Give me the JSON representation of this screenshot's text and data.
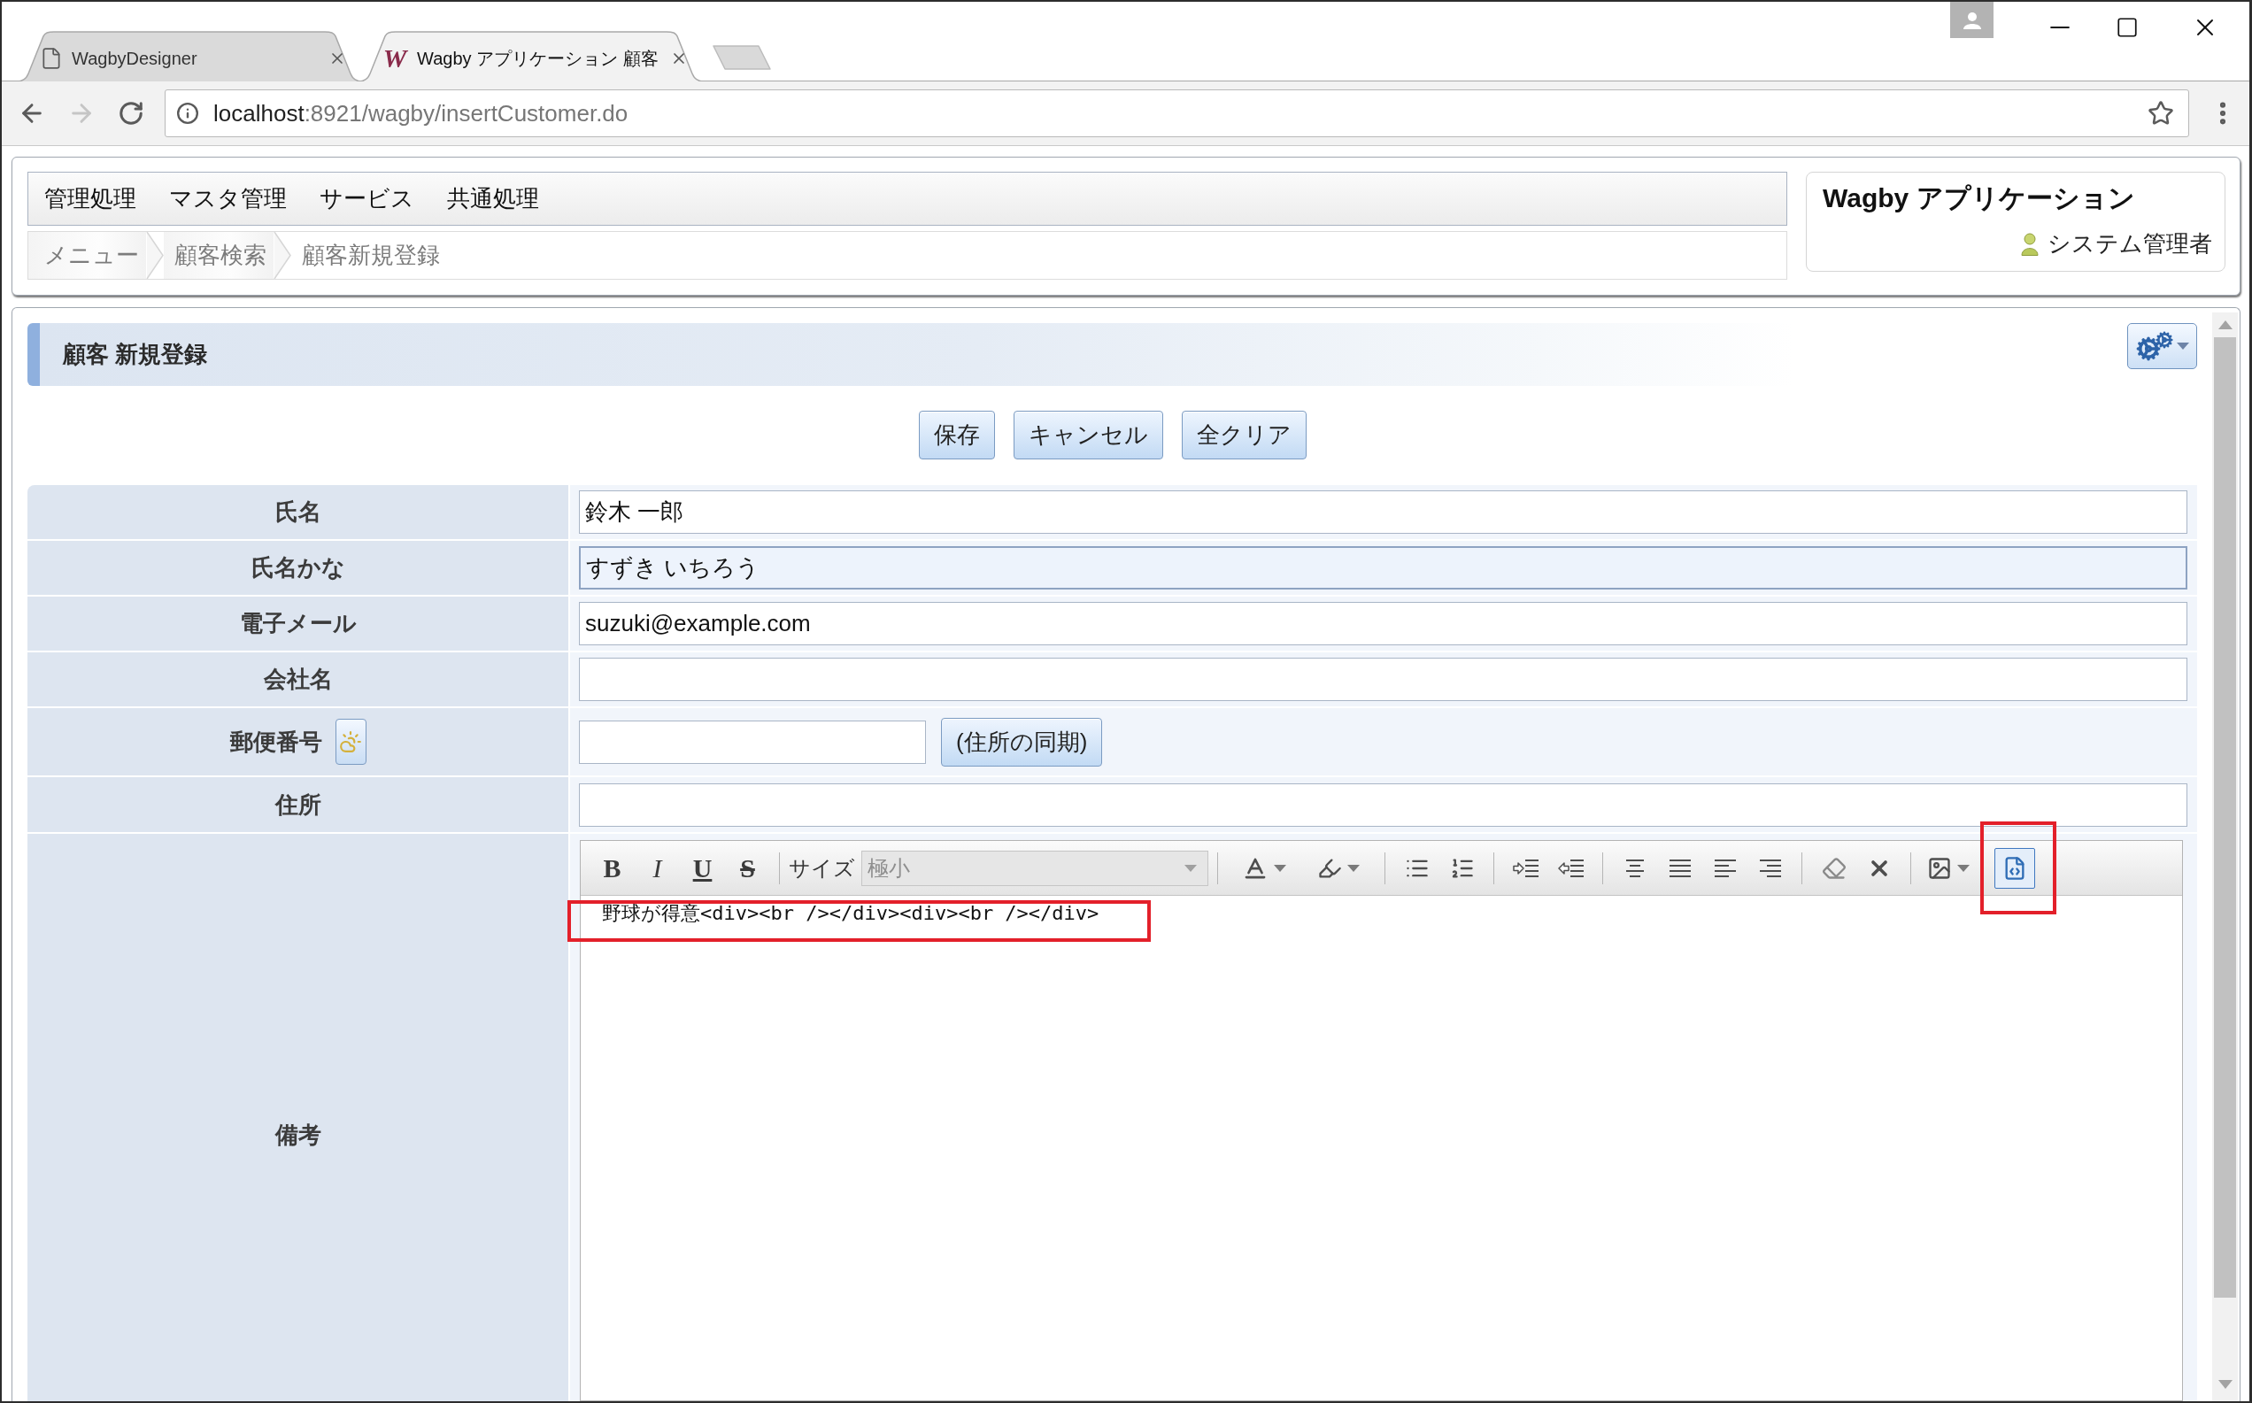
{
  "browser": {
    "tabs": [
      {
        "kind": "page",
        "title": "WagbyDesigner",
        "selected": false
      },
      {
        "kind": "app",
        "logo": "W",
        "title": "Wagby アプリケーション 顧客",
        "selected": true
      }
    ],
    "nav": {
      "back_disabled": false,
      "forward_disabled": true
    },
    "address": {
      "host": "localhost",
      "path": ":8921/wagby/insertCustomer.do"
    }
  },
  "menu": [
    "管理処理",
    "マスタ管理",
    "サービス",
    "共通処理"
  ],
  "breadcrumb": [
    "メニュー",
    "顧客検索",
    "顧客新規登録"
  ],
  "app": {
    "title": "Wagby アプリケーション",
    "user": "システム管理者"
  },
  "page_title": "顧客 新規登録",
  "actions": [
    "保存",
    "キャンセル",
    "全クリア"
  ],
  "form": [
    {
      "label": "氏名",
      "kind": "text",
      "value": "鈴木 一郎",
      "focused": false
    },
    {
      "label": "氏名かな",
      "kind": "text",
      "value": "すずき いちろう",
      "focused": true
    },
    {
      "label": "電子メール",
      "kind": "text",
      "value": "suzuki@example.com",
      "focused": false
    },
    {
      "label": "会社名",
      "kind": "text",
      "focused": false
    },
    {
      "label": "郵便番号",
      "kind": "postal",
      "focused": false,
      "button": "(住所の同期)"
    },
    {
      "label": "住所",
      "kind": "text",
      "focused": false
    },
    {
      "label": "備考",
      "kind": "richtext",
      "focused": false,
      "editor": {
        "format_buttons": [
          {
            "kind": "bold",
            "label": "B"
          },
          {
            "kind": "italic",
            "label": "I"
          },
          {
            "kind": "underline",
            "label": "U"
          },
          {
            "kind": "strike",
            "label": "S"
          }
        ],
        "size_label": "サイズ",
        "size_select": {
          "value": "極小",
          "disabled": true
        },
        "source_button": {
          "active": true,
          "highlighted": true
        },
        "content": "野球が得意<div><br /></div><div><br /></div>",
        "content_highlighted": true
      }
    }
  ]
}
